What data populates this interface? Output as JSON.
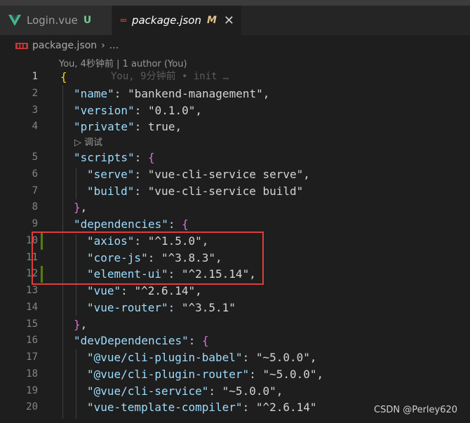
{
  "tabs": [
    {
      "name": "Login.vue",
      "badge": "U",
      "icon": "vue-icon",
      "active": false
    },
    {
      "name": "package.json",
      "badge": "M",
      "icon": "json-icon",
      "active": true
    }
  ],
  "close_glyph": "✕",
  "breadcrumb": {
    "file": "package.json",
    "sep": "›",
    "more": "..."
  },
  "blame": "You, 4秒钟前 | 1 author (You)",
  "ghost_blame": "You, 9分钟前 • init …",
  "codelens": "▷ 调试",
  "lines": [
    {
      "n": "1",
      "text": "{"
    },
    {
      "n": "2",
      "text": "\"name\": \"bankend-management\","
    },
    {
      "n": "3",
      "text": "\"version\": \"0.1.0\","
    },
    {
      "n": "4",
      "text": "\"private\": true,"
    },
    {
      "n": "5",
      "text": "\"scripts\": {"
    },
    {
      "n": "6",
      "text": "\"serve\": \"vue-cli-service serve\","
    },
    {
      "n": "7",
      "text": "\"build\": \"vue-cli-service build\""
    },
    {
      "n": "8",
      "text": "},"
    },
    {
      "n": "9",
      "text": "\"dependencies\": {"
    },
    {
      "n": "10",
      "text": "\"axios\": \"^1.5.0\","
    },
    {
      "n": "11",
      "text": "\"core-js\": \"^3.8.3\","
    },
    {
      "n": "12",
      "text": "\"element-ui\": \"^2.15.14\","
    },
    {
      "n": "13",
      "text": "\"vue\": \"^2.6.14\","
    },
    {
      "n": "14",
      "text": "\"vue-router\": \"^3.5.1\""
    },
    {
      "n": "15",
      "text": "},"
    },
    {
      "n": "16",
      "text": "\"devDependencies\": {"
    },
    {
      "n": "17",
      "text": "\"@vue/cli-plugin-babel\": \"~5.0.0\","
    },
    {
      "n": "18",
      "text": "\"@vue/cli-plugin-router\": \"~5.0.0\","
    },
    {
      "n": "19",
      "text": "\"@vue/cli-service\": \"~5.0.0\","
    },
    {
      "n": "20",
      "text": "\"vue-template-compiler\": \"^2.6.14\""
    }
  ],
  "watermark": "CSDN @Perley620",
  "colors": {
    "key": "#9cdcfe",
    "string": "#ce9178",
    "boolean": "#569cd6",
    "highlight": "#e23b3b",
    "modified": "#587c0c"
  }
}
